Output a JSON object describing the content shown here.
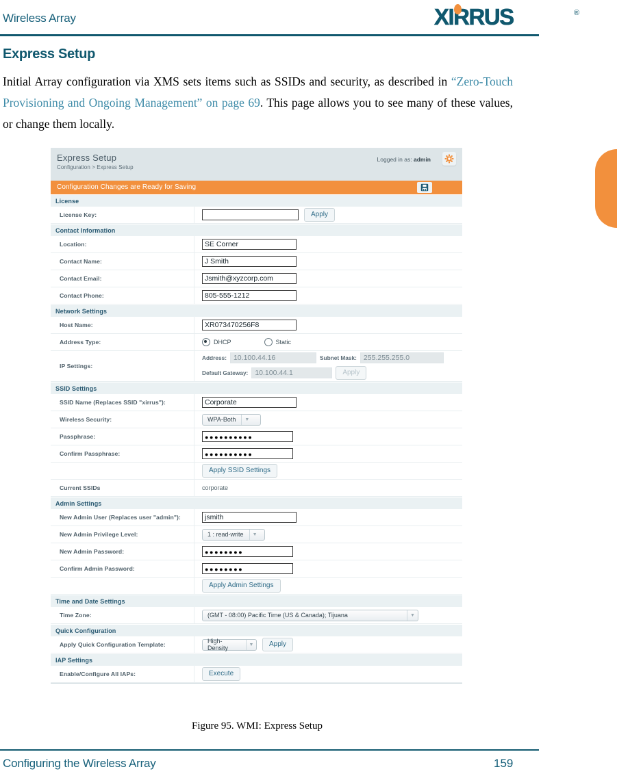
{
  "page": {
    "running_head": "Wireless Array",
    "section_title": "Express Setup",
    "paragraph_1_part1": "Initial Array configuration via XMS sets items such as SSIDs and security, as described in ",
    "paragraph_1_link": "“Zero-Touch Provisioning and Ongoing Management” on page 69",
    "paragraph_1_part2": ". This page allows you to see many of these values, or change them locally.",
    "figure_caption": "Figure 95. WMI: Express Setup",
    "footer_left": "Configuring the Wireless Array",
    "footer_page_number": "159",
    "logo_text": "XIRRUS",
    "logo_registered": "®"
  },
  "colors": {
    "brand_teal": "#10586e",
    "brand_orange": "#f2903d",
    "link_blue": "#3e8ba8",
    "panel_header_bg": "#dde5e8",
    "section_bg": "#eaf1f3"
  },
  "wmi": {
    "title": "Express Setup",
    "breadcrumb": "Configuration > Express Setup",
    "logged_in_prefix": "Logged in as:",
    "logged_in_user": "admin",
    "gear_icon": "gear-icon",
    "save_banner": "Configuration Changes are Ready for Saving",
    "save_icon": "floppy-disk-save-icon",
    "sections": {
      "license": {
        "heading": "License",
        "license_key_label": "License Key:",
        "license_key_value": "",
        "apply_label": "Apply"
      },
      "contact": {
        "heading": "Contact Information",
        "location_label": "Location:",
        "location_value": "SE Corner",
        "contact_name_label": "Contact Name:",
        "contact_name_value": "J Smith",
        "contact_email_label": "Contact Email:",
        "contact_email_value": "Jsmith@xyzcorp.com",
        "contact_phone_label": "Contact Phone:",
        "contact_phone_value": "805-555-1212"
      },
      "network": {
        "heading": "Network Settings",
        "host_name_label": "Host Name:",
        "host_name_value": "XR073470256F8",
        "address_type_label": "Address Type:",
        "dhcp_label": "DHCP",
        "static_label": "Static",
        "address_type_selected": "DHCP",
        "ip_settings_label": "IP Settings:",
        "address_label": "Address:",
        "address_value": "10.100.44.16",
        "subnet_mask_label": "Subnet Mask:",
        "subnet_mask_value": "255.255.255.0",
        "default_gateway_label": "Default Gateway:",
        "default_gateway_value": "10.100.44.1",
        "apply_label": "Apply"
      },
      "ssid": {
        "heading": "SSID Settings",
        "ssid_name_label": "SSID Name (Replaces SSID \"xirrus\"):",
        "ssid_name_value": "Corporate",
        "wireless_security_label": "Wireless Security:",
        "wireless_security_value": "WPA-Both",
        "passphrase_label": "Passphrase:",
        "passphrase_value": "●●●●●●●●●●",
        "confirm_passphrase_label": "Confirm Passphrase:",
        "confirm_passphrase_value": "●●●●●●●●●●",
        "apply_label": "Apply SSID Settings",
        "current_ssids_label": "Current SSIDs",
        "current_ssids_value": "corporate"
      },
      "admin": {
        "heading": "Admin Settings",
        "new_admin_user_label": "New Admin User (Replaces user \"admin\"):",
        "new_admin_user_value": "jsmith",
        "privilege_level_label": "New Admin Privilege Level:",
        "privilege_level_value": "1 : read-write",
        "new_password_label": "New Admin Password:",
        "new_password_value": "●●●●●●●●",
        "confirm_password_label": "Confirm Admin Password:",
        "confirm_password_value": "●●●●●●●●",
        "apply_label": "Apply Admin Settings"
      },
      "time": {
        "heading": "Time and Date Settings",
        "time_zone_label": "Time Zone:",
        "time_zone_value": "(GMT - 08:00) Pacific Time (US & Canada); Tijuana"
      },
      "quick": {
        "heading": "Quick Configuration",
        "template_label": "Apply Quick Configuration Template:",
        "template_value": "High-Density",
        "apply_label": "Apply"
      },
      "iap": {
        "heading": "IAP Settings",
        "enable_label": "Enable/Configure All IAPs:",
        "execute_label": "Execute"
      }
    }
  }
}
